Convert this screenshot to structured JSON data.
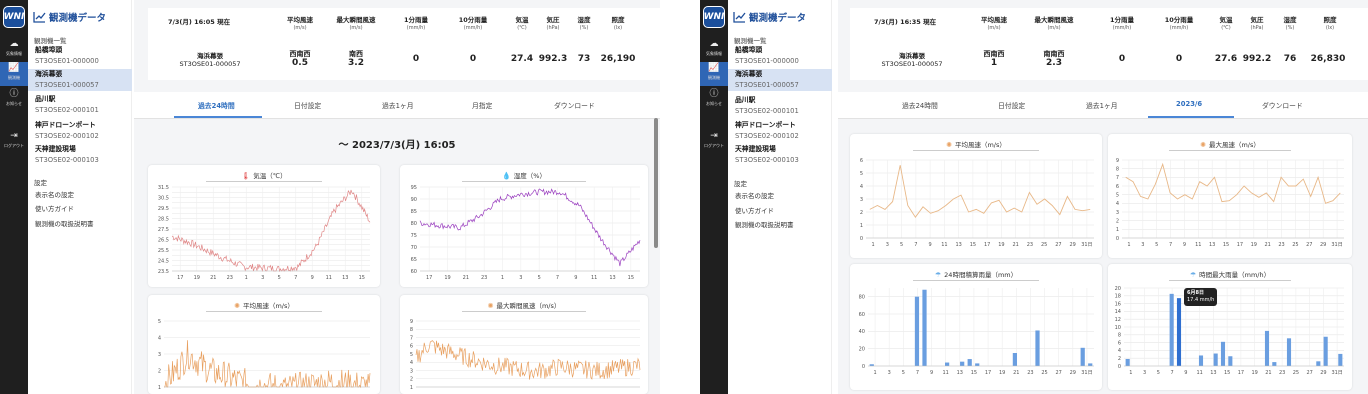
{
  "app": {
    "title": "観測機データ",
    "logo_text": "WNI",
    "rail": [
      {
        "icon": "cloud-icon",
        "label": "気象情報"
      },
      {
        "icon": "chart-icon",
        "label": "観測機"
      },
      {
        "icon": "info-icon",
        "label": "お知らせ"
      },
      {
        "icon": "logout-icon",
        "label": "ログアウト"
      }
    ],
    "list_header": "観測機一覧",
    "stations": [
      {
        "name": "船橋埠頭",
        "id": "ST3OSE01-000000"
      },
      {
        "name": "海浜幕張",
        "id": "ST3OSE01-000057"
      },
      {
        "name": "品川駅",
        "id": "ST3OSE02-000101"
      },
      {
        "name": "神戸ドローンポート",
        "id": "ST3OSE02-000102"
      },
      {
        "name": "天神建設現場",
        "id": "ST3OSE02-000103"
      }
    ],
    "settings_header": "設定",
    "settings": [
      "表示名の設定",
      "使い方ガイド",
      "観測機の取扱説明書"
    ],
    "tabs": [
      "過去24時間",
      "日付設定",
      "過去1ヶ月",
      "月指定",
      "ダウンロード"
    ],
    "table_headers": [
      {
        "label": "平均風速",
        "unit": "(m/s)"
      },
      {
        "label": "最大瞬間風速",
        "unit": "(m/s)"
      },
      {
        "label": "1分雨量",
        "unit": "(mm/h)"
      },
      {
        "label": "10分雨量",
        "unit": "(mm/h)"
      },
      {
        "label": "気温",
        "unit": "(℃)"
      },
      {
        "label": "気圧",
        "unit": "(hPa)"
      },
      {
        "label": "湿度",
        "unit": "(%)"
      },
      {
        "label": "照度",
        "unit": "(lx)"
      }
    ]
  },
  "left": {
    "time_label": "7/3(月) 16:05 現在",
    "station": {
      "name": "海浜幕張",
      "id": "ST3OSE01-000057"
    },
    "values": {
      "avg_wind_dir": "西南西",
      "avg_wind": "0.5",
      "max_wind_dir": "南西",
      "max_wind": "3.2",
      "rain_1min": "0",
      "rain_10min": "0",
      "temp": "27.4",
      "pressure": "992.3",
      "humidity": "73",
      "illuminance": "26,190"
    },
    "active_tab": 0,
    "range_heading": "～ 2023/7/3(月) 16:05",
    "charts": [
      {
        "title": "気温（℃）",
        "icon": "thermometer-icon"
      },
      {
        "title": "湿度（%）",
        "icon": "droplets-icon"
      },
      {
        "title": "平均風速（m/s）",
        "icon": "wind-icon"
      },
      {
        "title": "最大瞬間風速（m/s）",
        "icon": "wind-icon"
      }
    ]
  },
  "right": {
    "time_label": "7/3(月) 16:35 現在",
    "station": {
      "name": "海浜幕張",
      "id": "ST3OSE01-000057"
    },
    "values": {
      "avg_wind_dir": "西南西",
      "avg_wind": "1",
      "max_wind_dir": "南南西",
      "max_wind": "2.3",
      "rain_1min": "0",
      "rain_10min": "0",
      "temp": "27.6",
      "pressure": "992.2",
      "humidity": "76",
      "illuminance": "26,830"
    },
    "tabs": [
      "過去24時間",
      "日付設定",
      "過去1ヶ月",
      "2023/6",
      "ダウンロード"
    ],
    "active_tab": 3,
    "charts": [
      {
        "title": "平均風速（m/s）",
        "icon": "wind-icon"
      },
      {
        "title": "最大風速（m/s）",
        "icon": "wind-icon"
      },
      {
        "title": "24時間積算雨量（mm）",
        "icon": "umbrella-icon"
      },
      {
        "title": "時間最大雨量（mm/h）",
        "icon": "umbrella-icon"
      }
    ],
    "tooltip": {
      "date": "6月8日",
      "value": "17.4 mm/h"
    }
  },
  "chart_data": [
    {
      "type": "line",
      "title": "気温（℃）",
      "x": [
        "17",
        "19",
        "21",
        "23",
        "1",
        "3",
        "5",
        "7",
        "9",
        "11",
        "13",
        "15"
      ],
      "series": [
        {
          "values": [
            26.8,
            26.2,
            25.4,
            24.6,
            23.9,
            23.8,
            23.7,
            23.9,
            25.8,
            29.2,
            31.2,
            28.2
          ],
          "color": "#e08888"
        }
      ],
      "ylim": [
        23.5,
        31.5
      ],
      "yticks": [
        23.5,
        24,
        24.5,
        25,
        25.5,
        26,
        26.5,
        27,
        27.5,
        28,
        28.5,
        29,
        29.5,
        30,
        30.5,
        31,
        31.5
      ]
    },
    {
      "type": "line",
      "title": "湿度（%）",
      "x": [
        "17",
        "19",
        "21",
        "23",
        "1",
        "3",
        "5",
        "7",
        "9",
        "11",
        "13",
        "15"
      ],
      "series": [
        {
          "values": [
            80,
            79,
            78,
            83,
            90,
            92,
            93,
            93,
            87,
            74,
            63,
            73
          ],
          "color": "#9a3fbf"
        }
      ],
      "ylim": [
        60,
        95
      ],
      "yticks": [
        60,
        65,
        70,
        75,
        80,
        85,
        90,
        95
      ]
    },
    {
      "type": "line",
      "title": "平均風速（m/s）",
      "series": [
        {
          "values": [
            1.2,
            2.0,
            3.0,
            2.4,
            1.9,
            1.7,
            1.4,
            1.2,
            1.1,
            1.0,
            0.9,
            1.0,
            1.1,
            1.2,
            1.3,
            1.2,
            1.1,
            1.0
          ],
          "color": "#e8a060"
        }
      ],
      "ylim": [
        1,
        5
      ],
      "yticks": [
        1,
        2,
        3,
        4,
        5
      ]
    },
    {
      "type": "line",
      "title": "最大瞬間風速（m/s）",
      "series": [
        {
          "values": [
            4.5,
            6.2,
            5.5,
            5.0,
            4.5,
            4.0,
            3.6,
            3.4,
            3.1,
            2.9,
            3.1,
            3.5,
            3.2,
            3.1,
            3.0,
            3.2,
            3.4,
            3.6
          ],
          "color": "#e8a060"
        }
      ],
      "ylim": [
        1,
        9
      ],
      "yticks": [
        1,
        2,
        3,
        4,
        5,
        6,
        7,
        8,
        9
      ]
    },
    {
      "type": "line",
      "title": "平均風速（m/s）",
      "x": [
        "1",
        "3",
        "5",
        "7",
        "9",
        "11",
        "13",
        "15",
        "17",
        "19",
        "21",
        "23",
        "25",
        "27",
        "29",
        "31日"
      ],
      "series": [
        {
          "values": [
            2.2,
            2.5,
            2.2,
            2.8,
            5.6,
            2.5,
            1.6,
            2.4,
            1.9,
            2.1,
            2.5,
            3.0,
            3.3,
            2.0,
            2.2,
            1.9,
            2.7,
            2.9,
            2.0,
            2.3,
            2.0,
            3.5,
            2.6,
            3.0,
            2.5,
            1.8,
            3.2,
            2.2,
            2.1,
            2.2
          ],
          "color": "#e8b888"
        }
      ],
      "ylim": [
        0,
        6
      ],
      "yticks": [
        0,
        1,
        2,
        3,
        4,
        5,
        6
      ]
    },
    {
      "type": "line",
      "title": "最大風速（m/s）",
      "x": [
        "1",
        "3",
        "5",
        "7",
        "9",
        "11",
        "13",
        "15",
        "17",
        "19",
        "21",
        "23",
        "25",
        "27",
        "29",
        "31日"
      ],
      "series": [
        {
          "values": [
            7.0,
            6.5,
            4.8,
            4.5,
            6.2,
            8.5,
            5.2,
            4.5,
            5.0,
            4.5,
            6.5,
            6.0,
            7.0,
            4.2,
            4.3,
            5.0,
            6.0,
            5.2,
            4.7,
            5.2,
            4.2,
            7.0,
            6.0,
            6.0,
            6.8,
            4.8,
            7.0,
            4.0,
            4.3,
            5.2
          ],
          "color": "#e8b888"
        }
      ],
      "ylim": [
        0,
        9
      ],
      "yticks": [
        0,
        1,
        2,
        3,
        4,
        5,
        6,
        7,
        8,
        9
      ]
    },
    {
      "type": "bar",
      "title": "24時間積算雨量（mm）",
      "x": [
        "1",
        "3",
        "5",
        "7",
        "9",
        "11",
        "13",
        "15",
        "17",
        "19",
        "21",
        "23",
        "25",
        "27",
        "29",
        "31日"
      ],
      "values": [
        2,
        0,
        0,
        0,
        0,
        0,
        80,
        88,
        0,
        0,
        4,
        0,
        5,
        8,
        3,
        0,
        0,
        0,
        0,
        15,
        0,
        0,
        41,
        0,
        0,
        0,
        0,
        0,
        21,
        3
      ],
      "ylim": [
        0,
        90
      ],
      "yticks": [
        0,
        20,
        40,
        60,
        80
      ]
    },
    {
      "type": "bar",
      "title": "時間最大雨量（mm/h）",
      "x": [
        "1",
        "3",
        "5",
        "7",
        "9",
        "11",
        "13",
        "15",
        "17",
        "19",
        "21",
        "23",
        "25",
        "27",
        "29",
        "31日"
      ],
      "values": [
        1.8,
        0,
        0,
        0,
        0,
        0,
        18.5,
        17.4,
        0,
        0,
        2.7,
        0,
        3.2,
        6.2,
        2.5,
        0,
        0,
        0,
        0,
        9,
        1,
        0,
        7.1,
        0,
        0,
        0,
        1.2,
        7.5,
        0,
        3.1
      ],
      "ylim": [
        0,
        20
      ],
      "yticks": [
        0,
        2,
        4,
        6,
        8,
        10,
        12,
        14,
        16,
        18,
        20
      ]
    }
  ]
}
